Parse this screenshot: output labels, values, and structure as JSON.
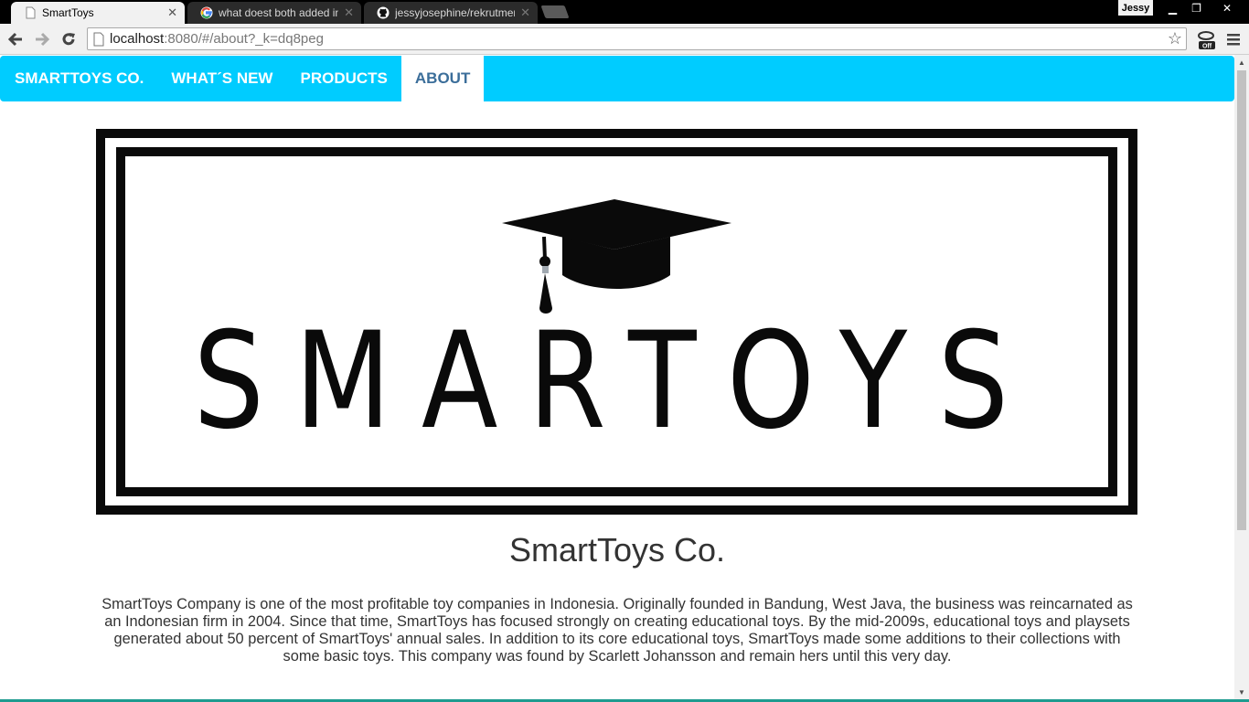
{
  "browser": {
    "tabs": [
      {
        "title": "SmartToys",
        "active": true,
        "icon": "page-icon"
      },
      {
        "title": "what doest both added in",
        "active": false,
        "icon": "google-icon"
      },
      {
        "title": "jessyjosephine/rekrutmen",
        "active": false,
        "icon": "github-icon"
      }
    ],
    "profile_name": "Jessy",
    "address": {
      "host": "localhost",
      "path": ":8080/#/about?_k=dq8peg"
    }
  },
  "nav": {
    "brand": "SMARTTOYS CO.",
    "items": [
      {
        "label": "WHAT´S NEW",
        "active": false
      },
      {
        "label": "PRODUCTS",
        "active": false
      },
      {
        "label": "ABOUT",
        "active": true
      }
    ]
  },
  "logo": {
    "wordmark": "SMARTOYS"
  },
  "about": {
    "title": "SmartToys Co.",
    "description": "SmartToys Company is one of the most profitable toy companies in Indonesia. Originally founded in Bandung, West Java, the business was reincarnated as an Indonesian firm in 2004. Since that time, SmartToys has focused strongly on creating educational toys. By the mid-2009s, educational toys and playsets generated about 50 percent of SmartToys' annual sales. In addition to its core educational toys, SmartToys made some additions to their collections with some basic toys. This company was found by Scarlett Johansson and remain hers until this very day."
  },
  "colors": {
    "navbar": "#00ccff",
    "active_link": "#3b6e9a",
    "text": "#333333"
  }
}
